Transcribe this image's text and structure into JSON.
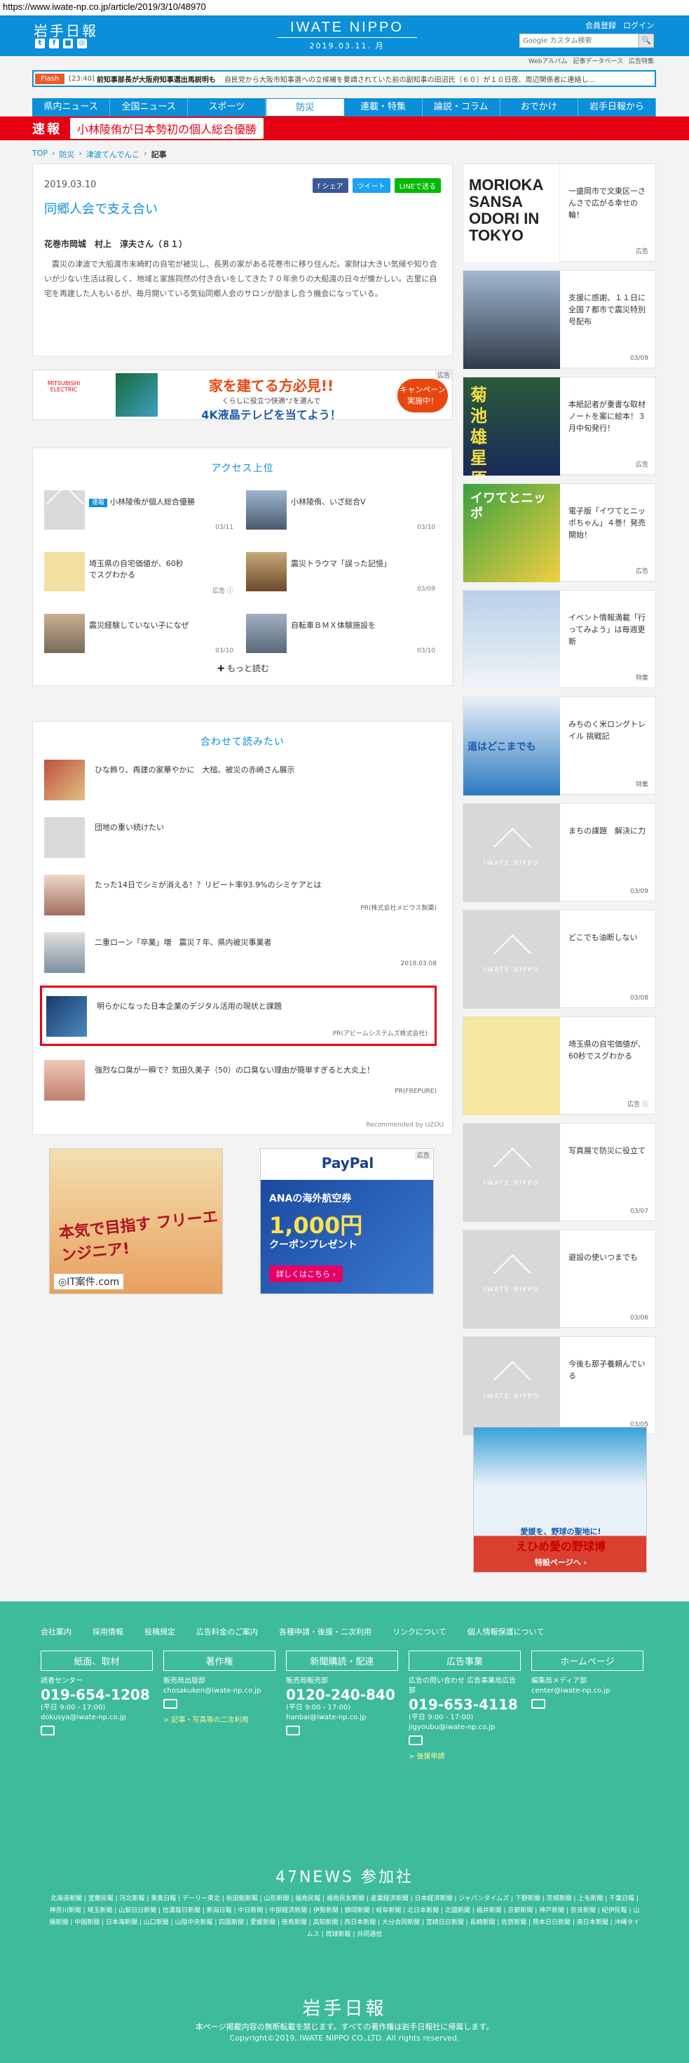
{
  "url": "https://www.iwate-np.co.jp/article/2019/3/10/48970",
  "header": {
    "logo_jp": "岩手日報",
    "logo_en": "IWATE NIPPO",
    "date": "2019.03.11. 月",
    "register": "会員登録",
    "login": "ログイン",
    "search_placeholder": "Google カスタム検索",
    "search_btn": "🔍",
    "sns": [
      "t",
      "f",
      "■",
      "◎"
    ]
  },
  "subnav": [
    "Webアルバム",
    "記事データベース",
    "広告特集"
  ],
  "flash": {
    "tag": "Flash",
    "time": "[23:40]",
    "headline": "前知事部長が大阪府知事選出馬説明も",
    "body": "自民党から大阪市知事選への立候補を要請されていた前の副知事の田沼氏（６０）が１０日夜、周辺関係者に連絡し..."
  },
  "gnav": [
    "県内ニュース",
    "全国ニュース",
    "スポーツ",
    "防災",
    "連載・特集",
    "論説・コラム",
    "おでかけ",
    "岩手日報から"
  ],
  "breaking": {
    "label": "速報",
    "title": "小林陵侑が日本勢初の個人総合優勝"
  },
  "breadcrumb": [
    "TOP",
    "防災",
    "津波てんでんこ",
    "記事"
  ],
  "article": {
    "date": "2019.03.10",
    "share": [
      "f シェア",
      "ツイート",
      "LINEで送る"
    ],
    "title": "同郷人会で支え合い",
    "byline": "花巻市岡城　村上　淳夫さん（８１）",
    "body": "震災の津波で大船渡市末崎町の自宅が被災し、長男の家がある花巻市に移り住んだ。家財は大きい気候や知り合いが少ない生活は寂しく、地域と家族同然の付き合いをしてきた７０年余りの大船渡の日々が懐かしい。古里に自宅を再建した人もいるが、毎月開いている気仙同郷人会のサロンが励まし合う機会になっている。"
  },
  "ad_top": {
    "brand": "MITSUBISHI ELECTRIC",
    "line1": "家を建てる方必見!!",
    "line2": "くらしに役立つ快適\"♪を選んで",
    "line3": "4K液晶テレビを当てよう！",
    "campaign": "キャンペーン実施中！",
    "tag": "広告"
  },
  "access": {
    "title": "アクセス上位",
    "items": [
      {
        "badge": "速報",
        "title": "小林陵侑が個人総合優勝",
        "date": "03/11"
      },
      {
        "badge": "",
        "title": "小林陵侑、いざ総合V",
        "date": "03/10"
      },
      {
        "badge": "",
        "title": "埼玉県の自宅価値が、60秒でスグわかる",
        "date": "広告 ⓘ"
      },
      {
        "badge": "",
        "title": "震災トラウマ「誤った記憶」",
        "date": "03/09"
      },
      {
        "badge": "",
        "title": "震災経験していない子になぜ",
        "date": "03/10"
      },
      {
        "badge": "",
        "title": "自転車ＢＭＸ体験施設を",
        "date": "03/10"
      }
    ],
    "more": "✚ もっと読む"
  },
  "recommend": {
    "title": "合わせて読みたい",
    "items": [
      {
        "title": "ひな飾り、再建の家華やかに　大槌、被災の赤崎さん展示",
        "source": ""
      },
      {
        "title": "団地の重い続けたい",
        "source": ""
      },
      {
        "title": "たった14日でシミが消える！？リピート率93.9%のシミケアとは",
        "source": "PR(株式会社メビウス製薬)"
      },
      {
        "title": "二重ローン「卒業」増　震災７年、県内被災事業者",
        "source": "2018.03.08"
      },
      {
        "title": "明らかになった日本企業のデジタル活用の現状と課題",
        "source": "PR(アビームシステムズ株式会社)"
      },
      {
        "title": "強烈な口臭が一瞬で？気田久美子（50）の口臭ない理由が簡単すぎると大炎上！",
        "source": "PR(FREPURE)"
      }
    ],
    "by": "Recommended by UZOU"
  },
  "ad_left": {
    "copy": "本気で目指す フリーエンジニア!",
    "logo": "◎IT案件.com"
  },
  "ad_right": {
    "brand": "PayPal",
    "line1": "ANAの海外航空券",
    "line2": "1,000円",
    "line3": "クーポンプレゼント",
    "btn": "詳しくはこちら ›",
    "tag": "広告"
  },
  "side": [
    {
      "title": "一盛岡市で文東区一さんさで広がる幸せの輪！",
      "date": "広告",
      "thumb_text": "MORIOKA SANSA ODORI IN TOKYO"
    },
    {
      "title": "支援に感謝、１１日に全国７都市で震災特別号配布",
      "date": "03/09",
      "thumb_text": ""
    },
    {
      "title": "本紙記者が重書な取材ノートを案に絵本！３月中旬発行！",
      "date": "広告",
      "thumb_text": "菊池雄星 原点"
    },
    {
      "title": "電子版「イワてとニッポちゃん」４巻！発売開始！",
      "date": "広告",
      "thumb_text": "イワてとニッポ"
    },
    {
      "title": "イベント情報満載「行ってみよう」は毎週更新",
      "date": "特集",
      "thumb_text": ""
    },
    {
      "title": "みちのく米ロングトレイル 挑戦記",
      "date": "特集",
      "thumb_text": "道はどこまでも"
    },
    {
      "title": "まちの課題　解決に力",
      "date": "03/09",
      "thumb_text": "IWATE NIPPO"
    },
    {
      "title": "どこでも油断しない",
      "date": "03/08",
      "thumb_text": "IWATE NIPPO"
    },
    {
      "title": "埼玉県の自宅価値が、60秒でスグわかる",
      "date": "広告 ⓘ",
      "thumb_text": ""
    },
    {
      "title": "写真展で防災に役立て",
      "date": "03/07",
      "thumb_text": "IWATE NIPPO"
    },
    {
      "title": "避設の使いつまでも",
      "date": "03/06",
      "thumb_text": "IWATE NIPPO"
    },
    {
      "title": "今後も那子養頼んでいる",
      "date": "03/05",
      "thumb_text": "IWATE NIPPO"
    }
  ],
  "side_ad": {
    "line1": "愛媛を、野球の聖地に!",
    "line2": "えひめ愛の野球博",
    "line3": "特設ページへ ›"
  },
  "footer": {
    "links": [
      "会社案内",
      "採用情報",
      "投稿規定",
      "広告料金のご案内",
      "各種申請・後援・二次利用",
      "リンクについて",
      "個人情報保護について"
    ],
    "cols": [
      {
        "head": "紙面、取材",
        "sub": "読者センター",
        "tel": "019-654-1208",
        "hours": "(平日 9:00 - 17:00)",
        "mail": "dokusya@iwate-np.co.jp",
        "link": ""
      },
      {
        "head": "著作権",
        "sub": "販売局出版部",
        "tel": "",
        "hours": "",
        "mail": "chosakuken@iwate-np.co.jp",
        "link": "> 記事・写真等の二次利用"
      },
      {
        "head": "新聞購読・配達",
        "sub": "販売局販売部",
        "tel": "0120-240-840",
        "hours": "(平日 9:00 - 17:00)",
        "mail": "hanbai@iwate-np.co.jp",
        "link": ""
      },
      {
        "head": "広告事業",
        "sub": "広告の問い合わせ 広告事業局広告部",
        "tel": "019-653-4118",
        "hours": "(平日 9:00 - 17:00)",
        "mail": "jigyoubu@iwate-np.co.jp",
        "link": "> 後援申請"
      },
      {
        "head": "ホームページ",
        "sub": "編集局メディア部",
        "tel": "",
        "hours": "",
        "mail": "center@iwate-np.co.jp",
        "link": ""
      }
    ],
    "news47": "47NEWS 参加社",
    "papers": "北海道新聞 | 室蘭民報 | 河北新報 | 東奥日報 | デーリー東北 | 秋田魁新報 | 山形新聞 | 福島民報 | 福島民友新聞 | 産業経済新聞 | 日本経済新聞 | ジャパンタイムズ | 下野新聞 | 茨城新聞 | 上毛新聞 | 千葉日報 | 神奈川新聞 | 埼玉新聞 | 山梨日日新聞 | 信濃毎日新聞 | 新潟日報 | 中日新聞 | 中部経済新聞 | 伊勢新聞 | 静岡新聞 | 岐阜新聞 | 北日本新聞 | 北國新聞 | 福井新聞 | 京都新聞 | 神戸新聞 | 奈良新聞 | 紀伊民報 | 山陽新聞 | 中国新聞 | 日本海新聞 | 山口新聞 | 山陰中央新報 | 四国新聞 | 愛媛新聞 | 徳島新聞 | 高知新聞 | 西日本新聞 | 大分合同新聞 | 宮崎日日新聞 | 長崎新聞 | 佐賀新聞 | 熊本日日新聞 | 南日本新聞 | 沖縄タイムス | 琉球新報 | 共同通信",
    "logo": "岩手日報",
    "note": "本ページ掲載内容の無断転載を禁じます。すべての著作権は岩手日報社に帰属します。",
    "copy": "Copyright©2019, IWATE NIPPO CO.,LTD. All rights reserved."
  }
}
